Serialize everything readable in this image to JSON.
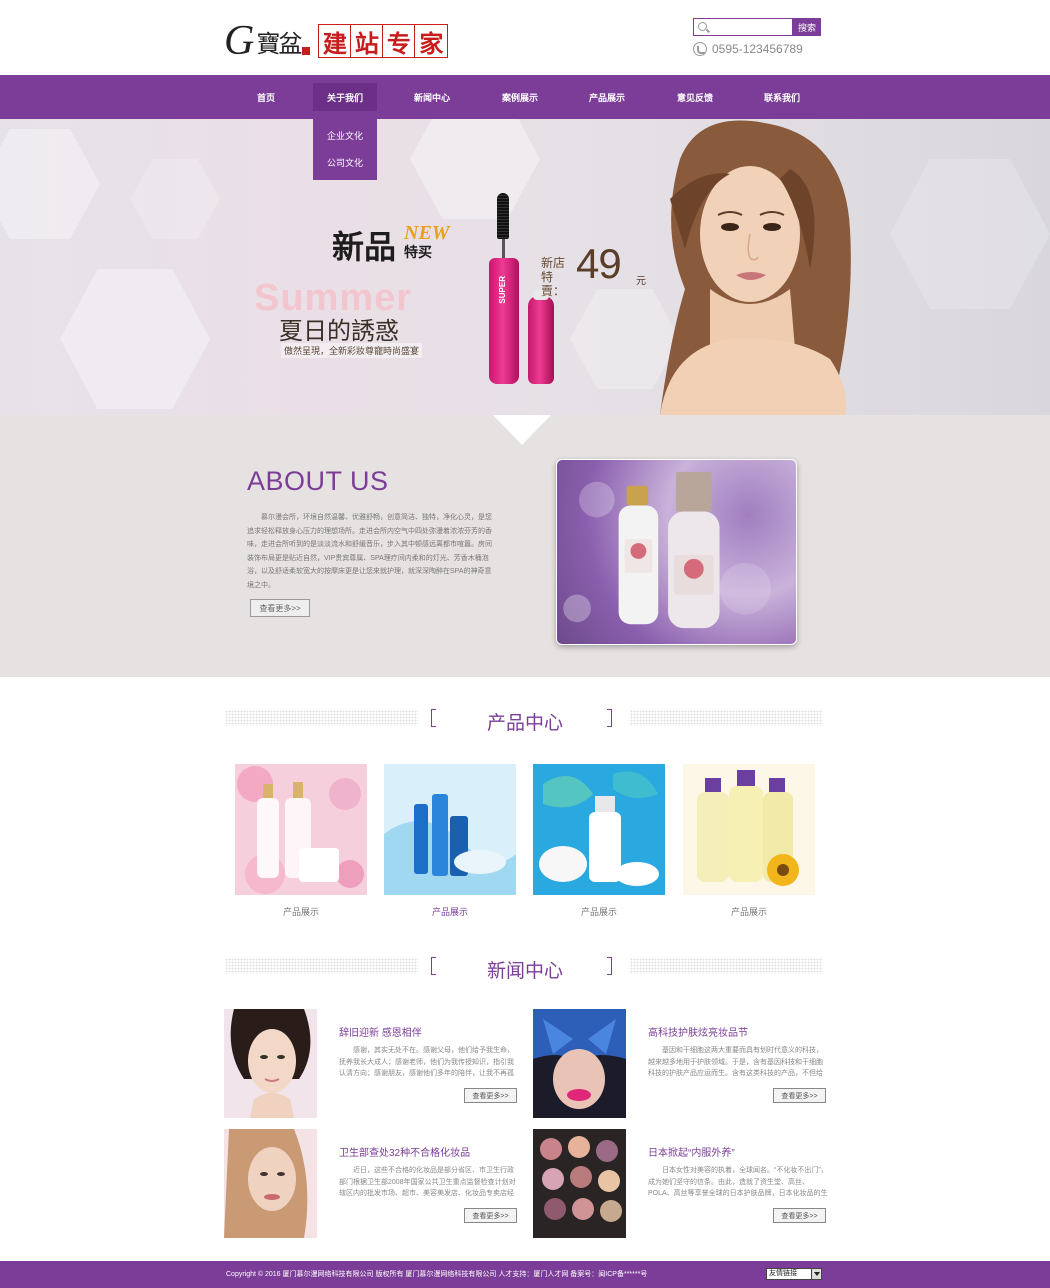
{
  "header": {
    "logo_g": "G",
    "logo_cn": "寶盆",
    "logo_boxes": [
      "建",
      "站",
      "专",
      "家"
    ],
    "search_button": "搜索",
    "search_placeholder": "",
    "phone": "0595-123456789"
  },
  "nav": {
    "items": [
      {
        "label": "首页"
      },
      {
        "label": "关于我们"
      },
      {
        "label": "新闻中心"
      },
      {
        "label": "案例展示"
      },
      {
        "label": "产品展示"
      },
      {
        "label": "意见反馈"
      },
      {
        "label": "联系我们"
      }
    ],
    "active_index": 1,
    "dropdown": [
      "企业文化",
      "公司文化"
    ]
  },
  "banner": {
    "new_text": "新品",
    "new_tag": "NEW",
    "special": "特买",
    "summer": "Summer",
    "summer_cn": "夏日的誘惑",
    "slogan": "傲然呈現，全新彩妝尊寵時尚盛宴",
    "price_caption": "新店特賣：",
    "price": "49",
    "price_unit": "元",
    "mascara_label": "SUPER"
  },
  "about": {
    "title": "ABOUT US",
    "text": "慕尔漫会所，环境自然温馨、优雅舒畅，创意简洁、独特，净化心灵，是您追求轻松释放身心压力的理想场所。走进会所内空气中四处弥漫着浓浓芬芳的香味，走进会所听到的是淡淡流水和舒缓音乐，步入其中顿感远离都市喧嚣。房间装饰布局更是贴近自然，VIP贵宾尊属、SPA理疗间内柔和的灯光、芳香木桶泡浴，以及舒适柔软宽大的按摩床更是让您来就护理，就深深陶醉在SPA的神奇意境之中。",
    "more": "查看更多>>"
  },
  "products": {
    "title": "产品中心",
    "items": [
      {
        "caption": "产品展示"
      },
      {
        "caption": "产品展示"
      },
      {
        "caption": "产品展示"
      },
      {
        "caption": "产品展示"
      }
    ],
    "active_index": 1
  },
  "news": {
    "title": "新闻中心",
    "items": [
      {
        "title": "辞旧迎新 感恩相伴",
        "text": "感谢，其实无处不在。感谢父母，他们给予我生命，抚养我长大成人；感谢老师，他们为我传授知识，指引我认清方向；感谢朋友，感谢他们多年的陪伴，让我不再孤单；感谢公司",
        "more": "查看更多>>"
      },
      {
        "title": "高科技护肤炫亮妆品节",
        "text": "基因和干细胞这两大重要而具有划时代意义的科技，越来越多地用于护肤领域。于是，含有基因科技和干细胞科技的护肤产品应运而生。含有这类科技的产品，不但给消费者带来",
        "more": "查看更多>>"
      },
      {
        "title": "卫生部查处32种不合格化妆品",
        "text": "近日，这些不合格的化妆品是部分省区、市卫生行政部门根据卫生部2008年国家公共卫生重点监督检查计划对辖区内的批发市场、超市、美容美发店、化妆品专卖店经营销售的",
        "more": "查看更多>>"
      },
      {
        "title": "日本掀起“内服外养”",
        "text": "日本女性对美容的执着，全球闻名。“不化妆不出门”，成为她们坚守的信条。由此，造就了资生堂、高丝、POLA、高丝等享誉全球的日本护肤品牌，日本化妆品的生产和消费",
        "more": "查看更多>>"
      }
    ]
  },
  "footer": {
    "text": "Copyright © 2016 厦门慕尔漫网络科技有限公司 版权所有 厦门慕尔漫网络科技有限公司 人才支持：厦门人才网 备案号：闽ICP备******号",
    "select_label": "友情链接"
  },
  "colors": {
    "brand": "#7b3d97",
    "seal_red": "#c81d1d",
    "footer": "#7b3d97"
  }
}
